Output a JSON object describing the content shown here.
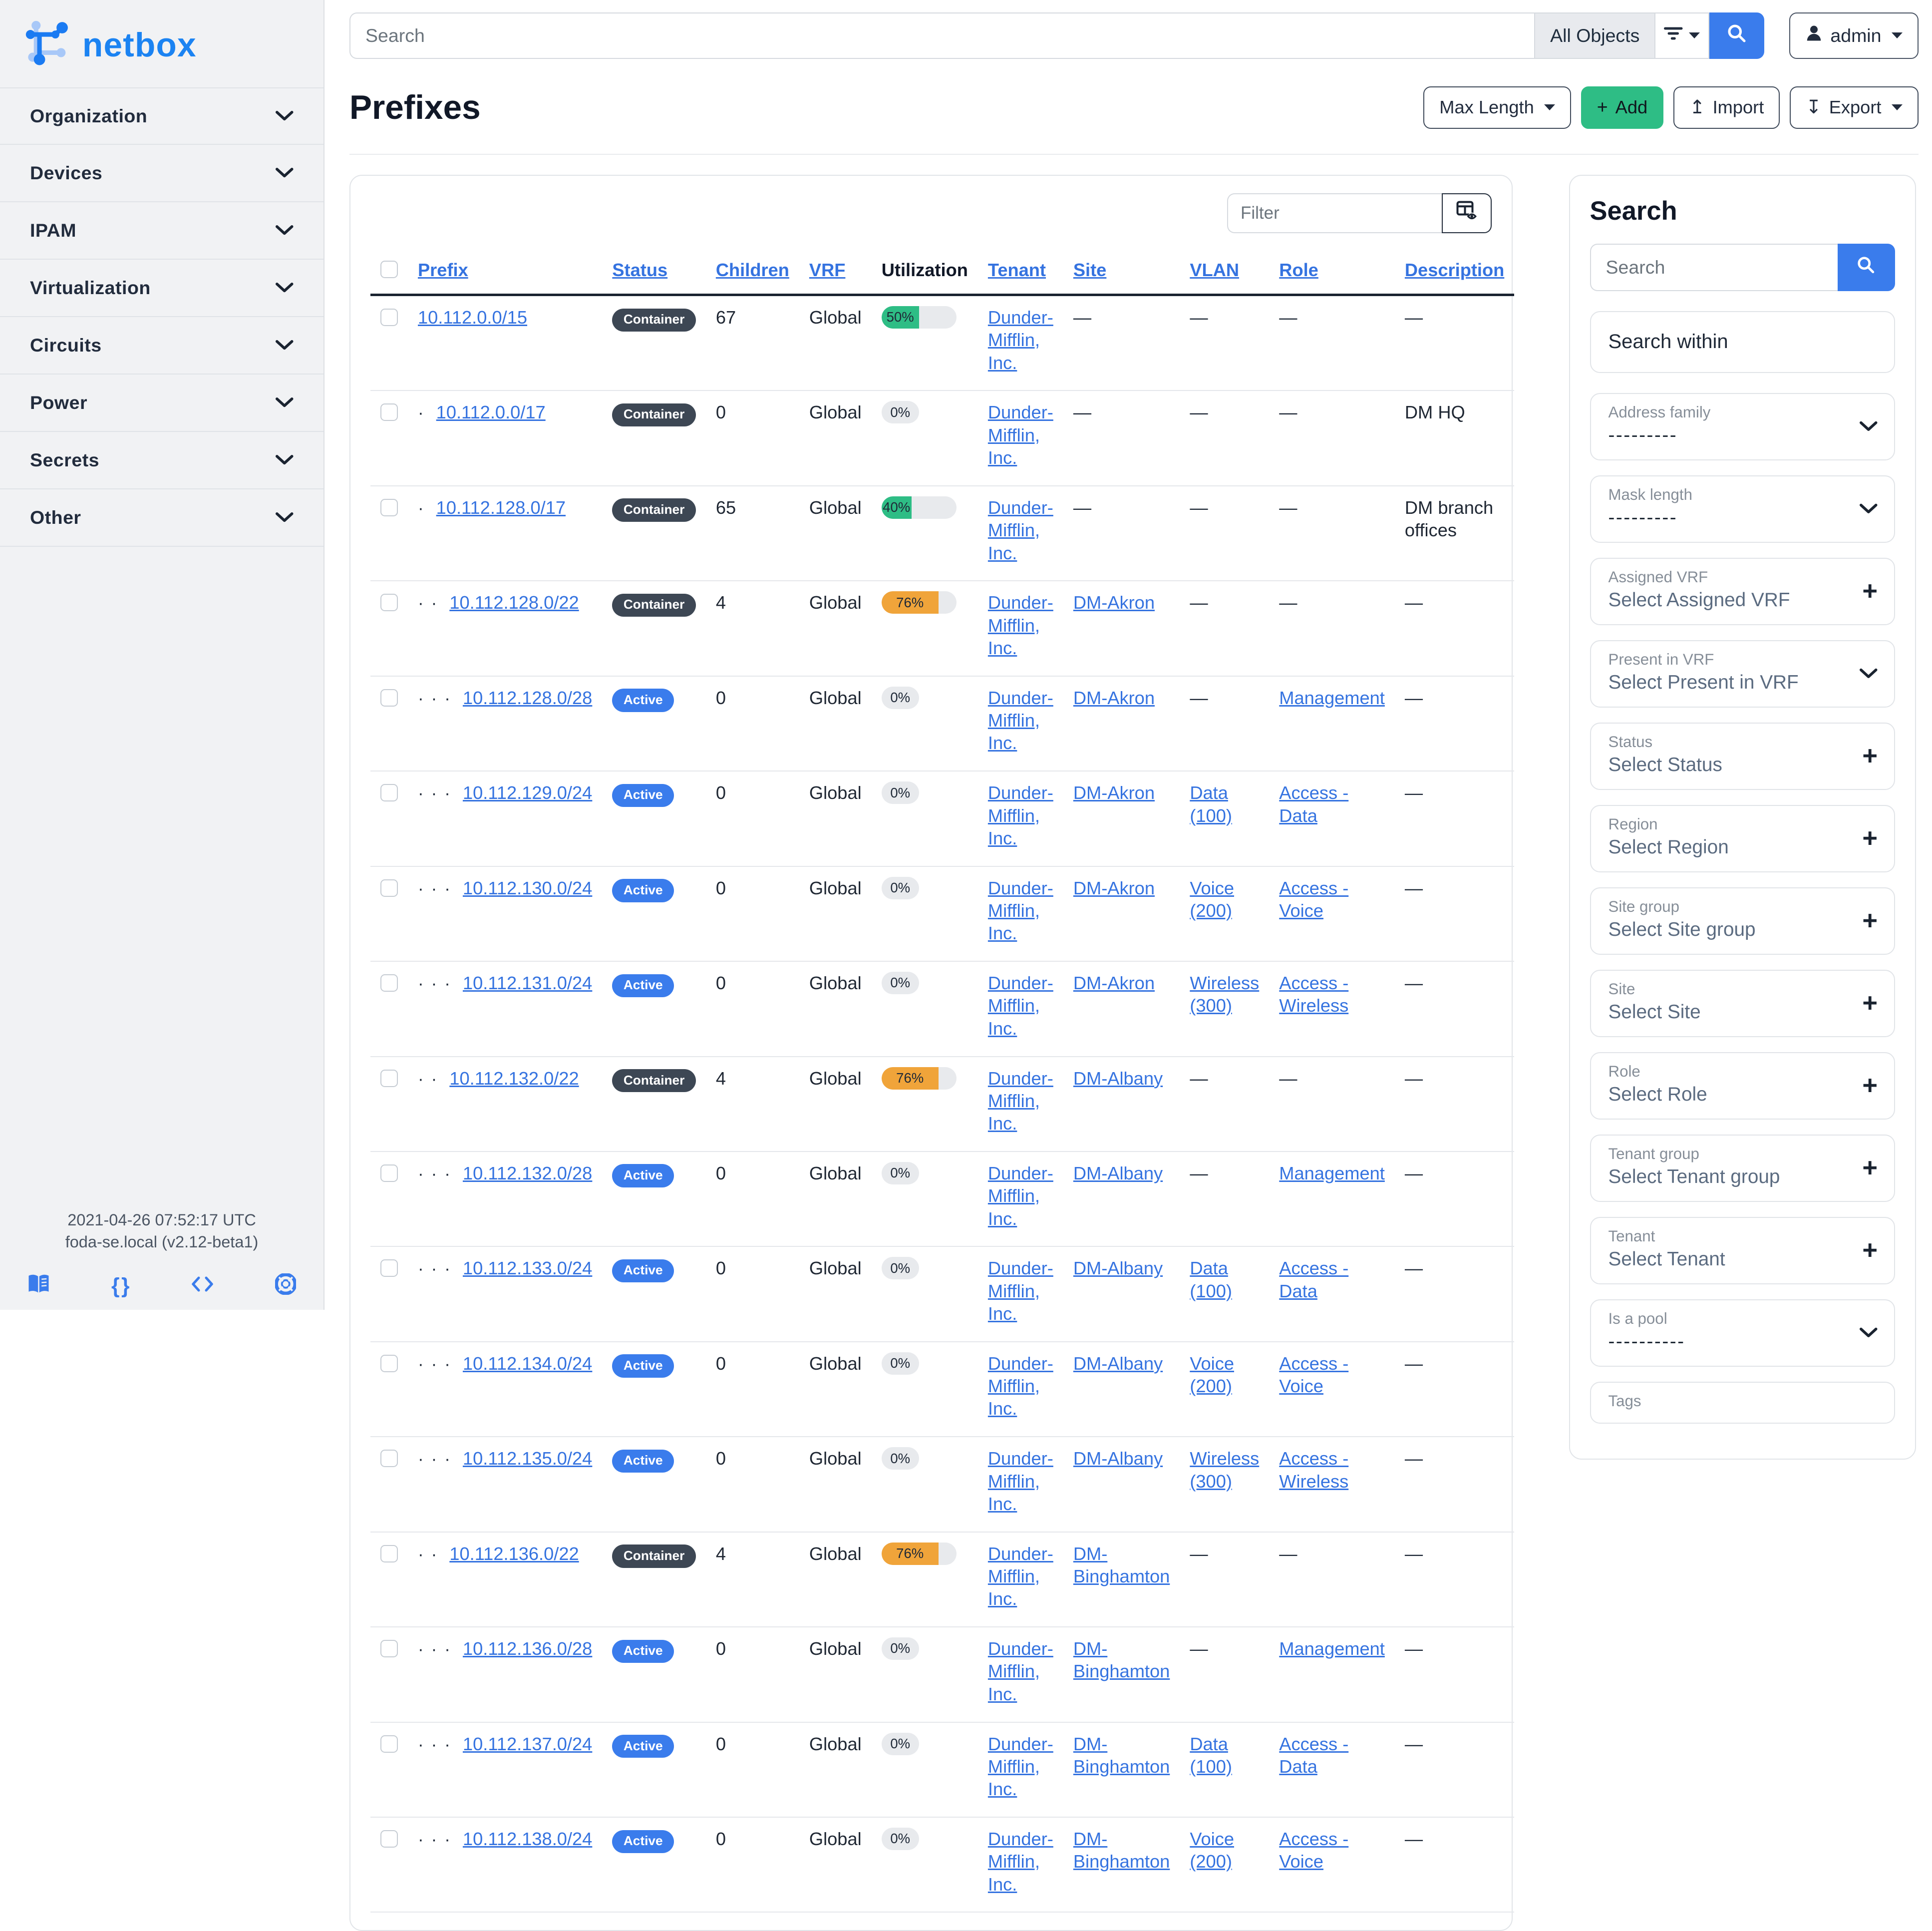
{
  "brand": {
    "name": "netbox"
  },
  "colors": {
    "accent_blue": "#3a7cec",
    "link_blue": "#3573e0",
    "success_green": "#2ebd85",
    "warning_orange": "#f0a43a",
    "container_badge": "#3d4754",
    "logo_blue": "#1b83f2"
  },
  "sidebar": {
    "items": [
      {
        "label": "Organization"
      },
      {
        "label": "Devices"
      },
      {
        "label": "IPAM"
      },
      {
        "label": "Virtualization"
      },
      {
        "label": "Circuits"
      },
      {
        "label": "Power"
      },
      {
        "label": "Secrets"
      },
      {
        "label": "Other"
      }
    ],
    "footer": {
      "timestamp": "2021-04-26 07:52:17 UTC",
      "host": "foda-se.local (v2.12-beta1)",
      "icons": [
        "docs-book-icon",
        "api-braces-icon",
        "code-icon",
        "help-lifebuoy-icon"
      ]
    }
  },
  "topbar": {
    "search_placeholder": "Search",
    "scope_label": "All Objects",
    "user_label": "admin"
  },
  "page": {
    "title": "Prefixes",
    "buttons": {
      "max_length": "Max Length",
      "add": "Add",
      "import": "Import",
      "export": "Export"
    }
  },
  "table": {
    "filter_placeholder": "Filter",
    "headers": [
      {
        "label": "Prefix",
        "link": true
      },
      {
        "label": "Status",
        "link": true
      },
      {
        "label": "Children",
        "link": true
      },
      {
        "label": "VRF",
        "link": true
      },
      {
        "label": "Utilization",
        "link": false
      },
      {
        "label": "Tenant",
        "link": true
      },
      {
        "label": "Site",
        "link": true
      },
      {
        "label": "VLAN",
        "link": true
      },
      {
        "label": "Role",
        "link": true
      },
      {
        "label": "Description",
        "link": true
      }
    ],
    "empty_marker": "—",
    "rows": [
      {
        "prefix": "10.112.0.0/15",
        "depth": 0,
        "status": "Container",
        "children": "67",
        "vrf": "Global",
        "util_pct": 50,
        "util_variant": "success",
        "tenant": "Dunder-Mifflin, Inc.",
        "site": "",
        "vlan": "",
        "role": "",
        "description": ""
      },
      {
        "prefix": "10.112.0.0/17",
        "depth": 1,
        "status": "Container",
        "children": "0",
        "vrf": "Global",
        "util_pct": 0,
        "util_variant": "empty",
        "tenant": "Dunder-Mifflin, Inc.",
        "site": "",
        "vlan": "",
        "role": "",
        "description": "DM HQ"
      },
      {
        "prefix": "10.112.128.0/17",
        "depth": 1,
        "status": "Container",
        "children": "65",
        "vrf": "Global",
        "util_pct": 40,
        "util_variant": "success",
        "tenant": "Dunder-Mifflin, Inc.",
        "site": "",
        "vlan": "",
        "role": "",
        "description": "DM branch offices"
      },
      {
        "prefix": "10.112.128.0/22",
        "depth": 2,
        "status": "Container",
        "children": "4",
        "vrf": "Global",
        "util_pct": 76,
        "util_variant": "warning",
        "tenant": "Dunder-Mifflin, Inc.",
        "site": "DM-Akron",
        "vlan": "",
        "role": "",
        "description": ""
      },
      {
        "prefix": "10.112.128.0/28",
        "depth": 3,
        "status": "Active",
        "children": "0",
        "vrf": "Global",
        "util_pct": 0,
        "util_variant": "empty",
        "tenant": "Dunder-Mifflin, Inc.",
        "site": "DM-Akron",
        "vlan": "",
        "role": "Management",
        "description": ""
      },
      {
        "prefix": "10.112.129.0/24",
        "depth": 3,
        "status": "Active",
        "children": "0",
        "vrf": "Global",
        "util_pct": 0,
        "util_variant": "empty",
        "tenant": "Dunder-Mifflin, Inc.",
        "site": "DM-Akron",
        "vlan": "Data (100)",
        "role": "Access - Data",
        "description": ""
      },
      {
        "prefix": "10.112.130.0/24",
        "depth": 3,
        "status": "Active",
        "children": "0",
        "vrf": "Global",
        "util_pct": 0,
        "util_variant": "empty",
        "tenant": "Dunder-Mifflin, Inc.",
        "site": "DM-Akron",
        "vlan": "Voice (200)",
        "role": "Access - Voice",
        "description": ""
      },
      {
        "prefix": "10.112.131.0/24",
        "depth": 3,
        "status": "Active",
        "children": "0",
        "vrf": "Global",
        "util_pct": 0,
        "util_variant": "empty",
        "tenant": "Dunder-Mifflin, Inc.",
        "site": "DM-Akron",
        "vlan": "Wireless (300)",
        "role": "Access - Wireless",
        "description": ""
      },
      {
        "prefix": "10.112.132.0/22",
        "depth": 2,
        "status": "Container",
        "children": "4",
        "vrf": "Global",
        "util_pct": 76,
        "util_variant": "warning",
        "tenant": "Dunder-Mifflin, Inc.",
        "site": "DM-Albany",
        "vlan": "",
        "role": "",
        "description": ""
      },
      {
        "prefix": "10.112.132.0/28",
        "depth": 3,
        "status": "Active",
        "children": "0",
        "vrf": "Global",
        "util_pct": 0,
        "util_variant": "empty",
        "tenant": "Dunder-Mifflin, Inc.",
        "site": "DM-Albany",
        "vlan": "",
        "role": "Management",
        "description": ""
      },
      {
        "prefix": "10.112.133.0/24",
        "depth": 3,
        "status": "Active",
        "children": "0",
        "vrf": "Global",
        "util_pct": 0,
        "util_variant": "empty",
        "tenant": "Dunder-Mifflin, Inc.",
        "site": "DM-Albany",
        "vlan": "Data (100)",
        "role": "Access - Data",
        "description": ""
      },
      {
        "prefix": "10.112.134.0/24",
        "depth": 3,
        "status": "Active",
        "children": "0",
        "vrf": "Global",
        "util_pct": 0,
        "util_variant": "empty",
        "tenant": "Dunder-Mifflin, Inc.",
        "site": "DM-Albany",
        "vlan": "Voice (200)",
        "role": "Access - Voice",
        "description": ""
      },
      {
        "prefix": "10.112.135.0/24",
        "depth": 3,
        "status": "Active",
        "children": "0",
        "vrf": "Global",
        "util_pct": 0,
        "util_variant": "empty",
        "tenant": "Dunder-Mifflin, Inc.",
        "site": "DM-Albany",
        "vlan": "Wireless (300)",
        "role": "Access - Wireless",
        "description": ""
      },
      {
        "prefix": "10.112.136.0/22",
        "depth": 2,
        "status": "Container",
        "children": "4",
        "vrf": "Global",
        "util_pct": 76,
        "util_variant": "warning",
        "tenant": "Dunder-Mifflin, Inc.",
        "site": "DM-Binghamton",
        "vlan": "",
        "role": "",
        "description": ""
      },
      {
        "prefix": "10.112.136.0/28",
        "depth": 3,
        "status": "Active",
        "children": "0",
        "vrf": "Global",
        "util_pct": 0,
        "util_variant": "empty",
        "tenant": "Dunder-Mifflin, Inc.",
        "site": "DM-Binghamton",
        "vlan": "",
        "role": "Management",
        "description": ""
      },
      {
        "prefix": "10.112.137.0/24",
        "depth": 3,
        "status": "Active",
        "children": "0",
        "vrf": "Global",
        "util_pct": 0,
        "util_variant": "empty",
        "tenant": "Dunder-Mifflin, Inc.",
        "site": "DM-Binghamton",
        "vlan": "Data (100)",
        "role": "Access - Data",
        "description": ""
      },
      {
        "prefix": "10.112.138.0/24",
        "depth": 3,
        "status": "Active",
        "children": "0",
        "vrf": "Global",
        "util_pct": 0,
        "util_variant": "empty",
        "tenant": "Dunder-Mifflin, Inc.",
        "site": "DM-Binghamton",
        "vlan": "Voice (200)",
        "role": "Access - Voice",
        "description": ""
      }
    ]
  },
  "filters_panel": {
    "title": "Search",
    "search_placeholder": "Search",
    "within_label": "Search within",
    "fields": [
      {
        "label": "Address family",
        "value": "---------",
        "style": "dashes",
        "control": "chevron"
      },
      {
        "label": "Mask length",
        "value": "---------",
        "style": "dashes",
        "control": "chevron"
      },
      {
        "label": "Assigned VRF",
        "value": "Select Assigned VRF",
        "style": "placeholder",
        "control": "plus"
      },
      {
        "label": "Present in VRF",
        "value": "Select Present in VRF",
        "style": "placeholder",
        "control": "chevron"
      },
      {
        "label": "Status",
        "value": "Select Status",
        "style": "placeholder",
        "control": "plus"
      },
      {
        "label": "Region",
        "value": "Select Region",
        "style": "placeholder",
        "control": "plus"
      },
      {
        "label": "Site group",
        "value": "Select Site group",
        "style": "placeholder",
        "control": "plus"
      },
      {
        "label": "Site",
        "value": "Select Site",
        "style": "placeholder",
        "control": "plus"
      },
      {
        "label": "Role",
        "value": "Select Role",
        "style": "placeholder",
        "control": "plus"
      },
      {
        "label": "Tenant group",
        "value": "Select Tenant group",
        "style": "placeholder",
        "control": "plus"
      },
      {
        "label": "Tenant",
        "value": "Select Tenant",
        "style": "placeholder",
        "control": "plus"
      },
      {
        "label": "Is a pool",
        "value": "----------",
        "style": "dashes",
        "control": "chevron"
      },
      {
        "label": "Tags",
        "value": "",
        "style": "placeholder",
        "control": "none"
      }
    ]
  }
}
